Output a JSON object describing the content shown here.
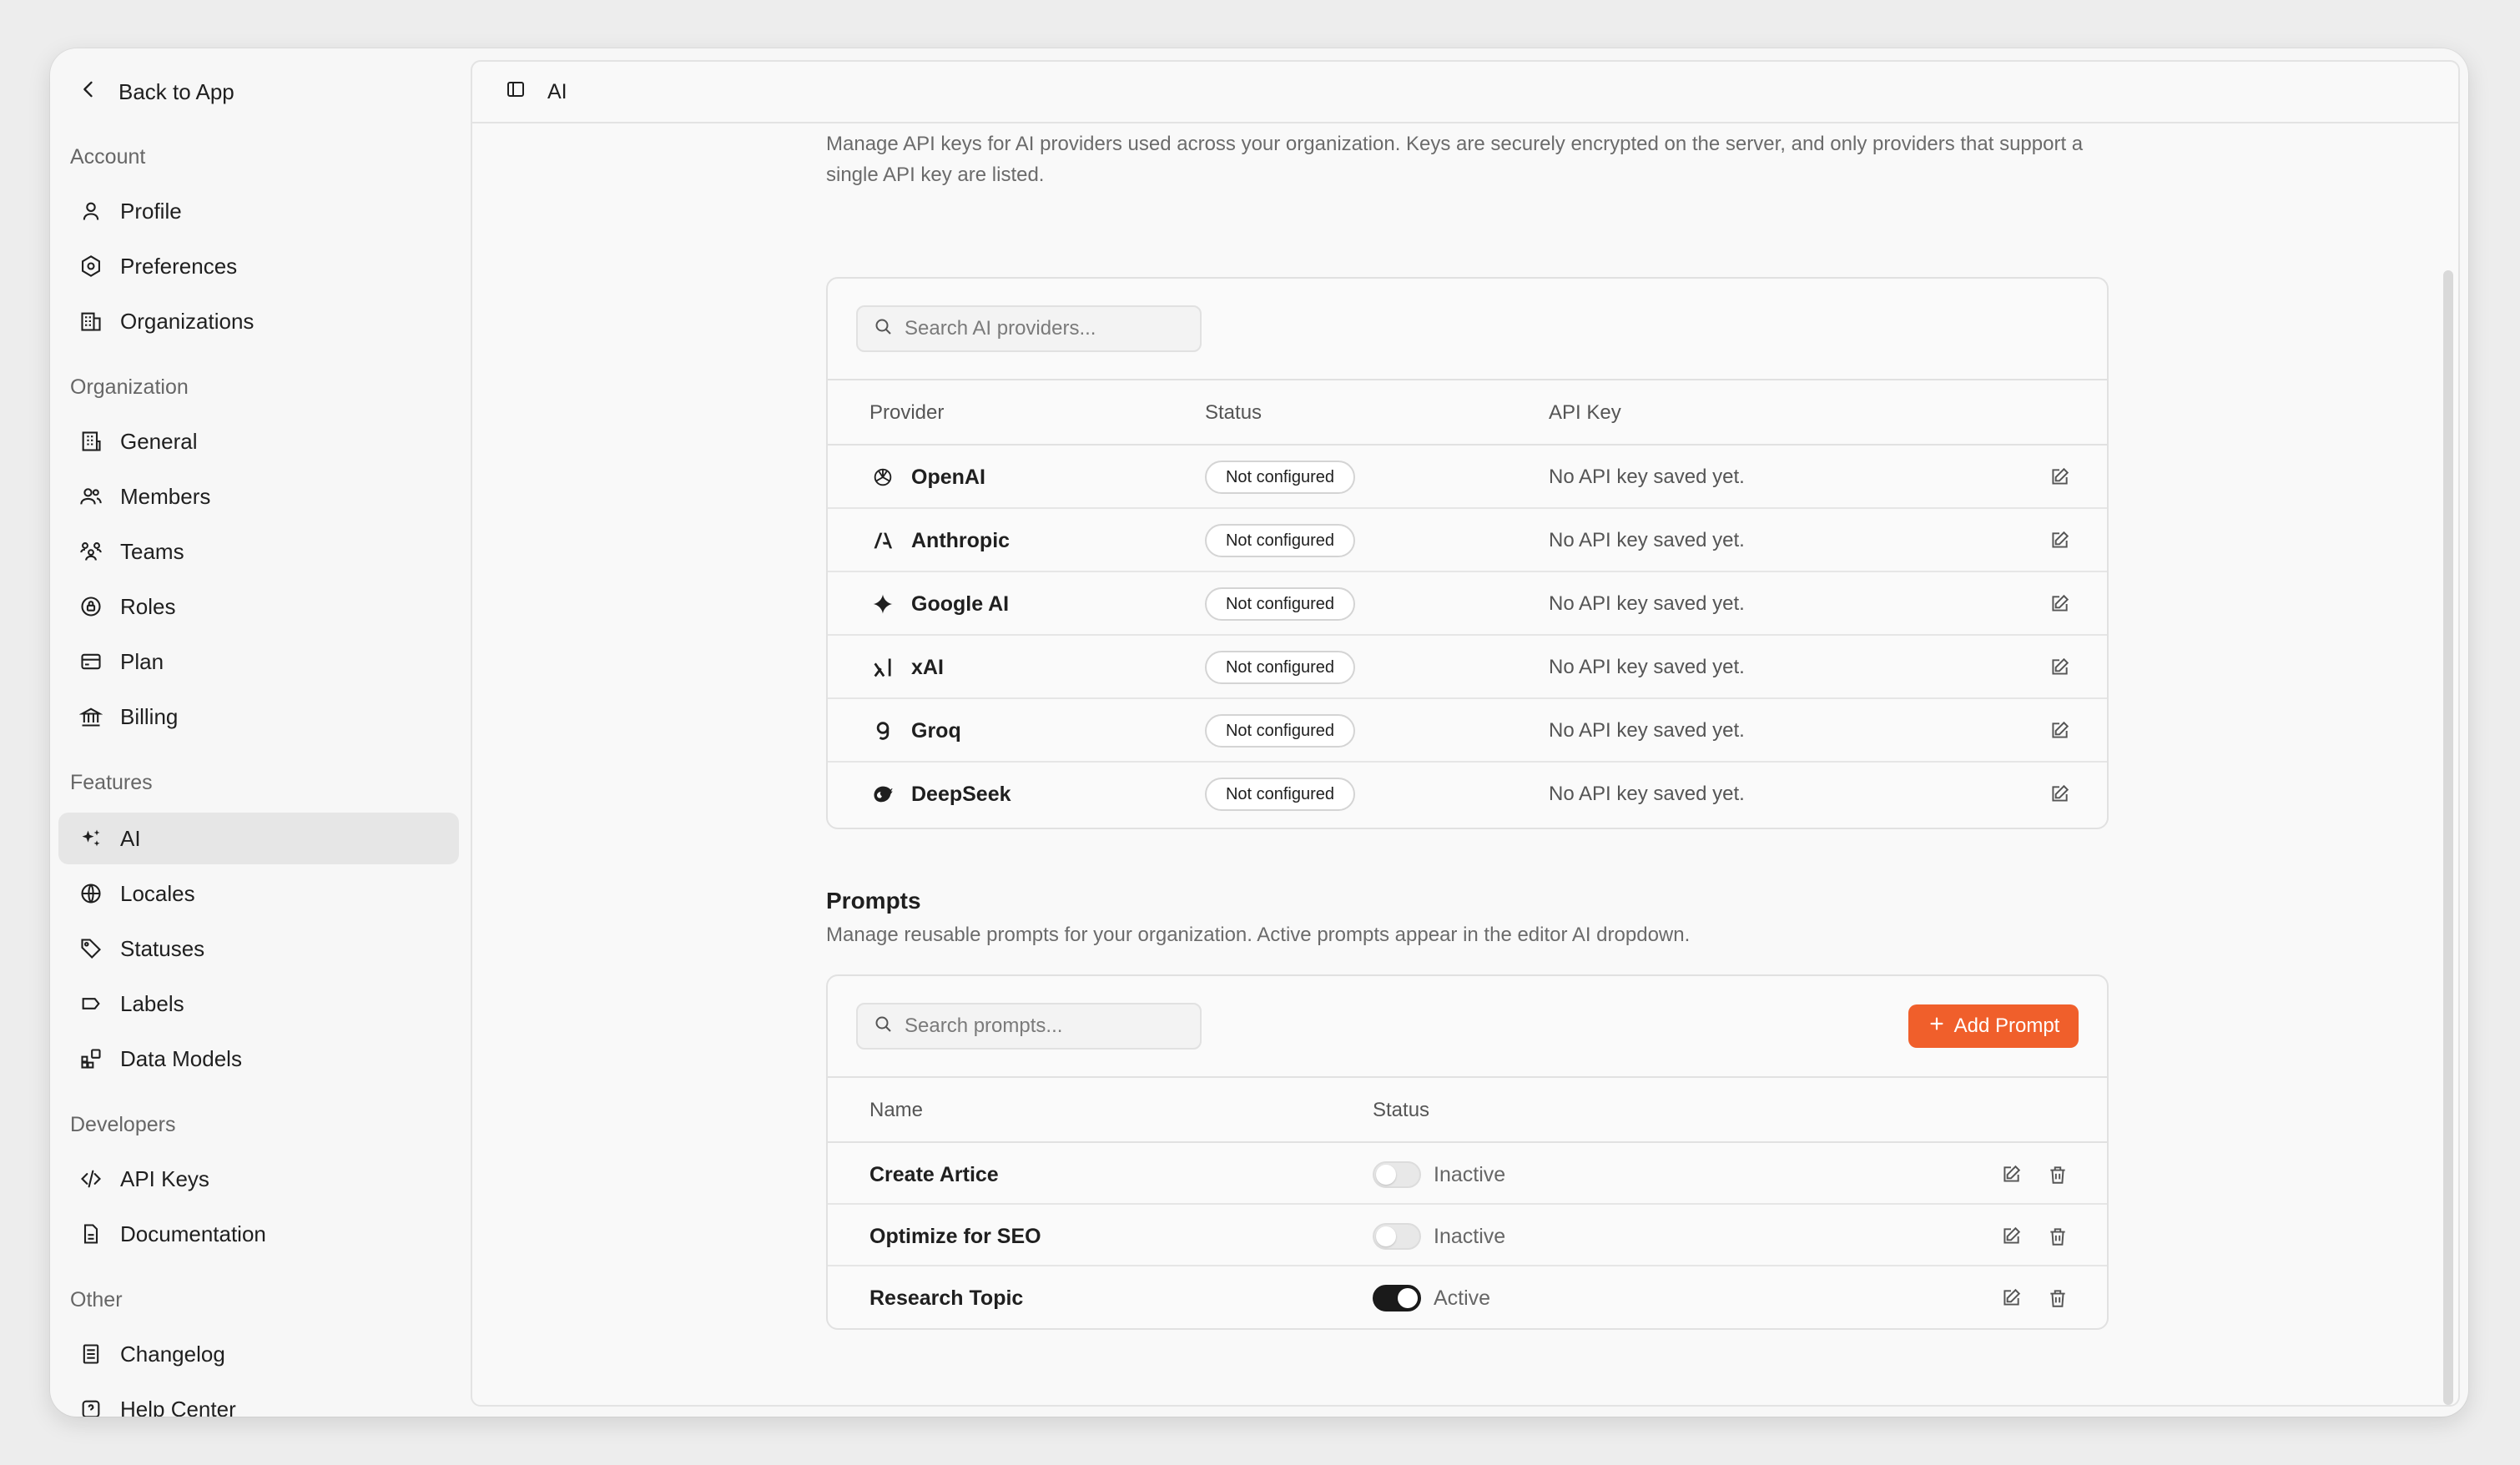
{
  "sidebar": {
    "back_label": "Back to App",
    "sections": {
      "account": "Account",
      "organization": "Organization",
      "features": "Features",
      "developers": "Developers",
      "other": "Other"
    },
    "items": {
      "profile": "Profile",
      "preferences": "Preferences",
      "organizations": "Organizations",
      "general": "General",
      "members": "Members",
      "teams": "Teams",
      "roles": "Roles",
      "plan": "Plan",
      "billing": "Billing",
      "ai": "AI",
      "locales": "Locales",
      "statuses": "Statuses",
      "labels": "Labels",
      "data_models": "Data Models",
      "api_keys": "API Keys",
      "documentation": "Documentation",
      "changelog": "Changelog",
      "help_center": "Help Center"
    },
    "active_item": "ai"
  },
  "topbar": {
    "title": "AI"
  },
  "providers": {
    "description": "Manage API keys for AI providers used across your organization. Keys are securely encrypted on the server, and only providers that support a single API key are listed.",
    "search_placeholder": "Search AI providers...",
    "columns": {
      "provider": "Provider",
      "status": "Status",
      "api_key": "API Key"
    },
    "rows": [
      {
        "name": "OpenAI",
        "icon": "openai-icon",
        "status": "Not configured",
        "key": "No API key saved yet."
      },
      {
        "name": "Anthropic",
        "icon": "anthropic-icon",
        "status": "Not configured",
        "key": "No API key saved yet."
      },
      {
        "name": "Google AI",
        "icon": "google-ai-icon",
        "status": "Not configured",
        "key": "No API key saved yet."
      },
      {
        "name": "xAI",
        "icon": "xai-icon",
        "status": "Not configured",
        "key": "No API key saved yet."
      },
      {
        "name": "Groq",
        "icon": "groq-icon",
        "status": "Not configured",
        "key": "No API key saved yet."
      },
      {
        "name": "DeepSeek",
        "icon": "deepseek-icon",
        "status": "Not configured",
        "key": "No API key saved yet."
      }
    ]
  },
  "prompts": {
    "title": "Prompts",
    "description": "Manage reusable prompts for your organization. Active prompts appear in the editor AI dropdown.",
    "search_placeholder": "Search prompts...",
    "add_label": "Add Prompt",
    "accent_color": "#f05f2b",
    "columns": {
      "name": "Name",
      "status": "Status"
    },
    "rows": [
      {
        "name": "Create Artice",
        "status": "Inactive",
        "active": false
      },
      {
        "name": "Optimize for SEO",
        "status": "Inactive",
        "active": false
      },
      {
        "name": "Research Topic",
        "status": "Active",
        "active": true
      }
    ]
  }
}
